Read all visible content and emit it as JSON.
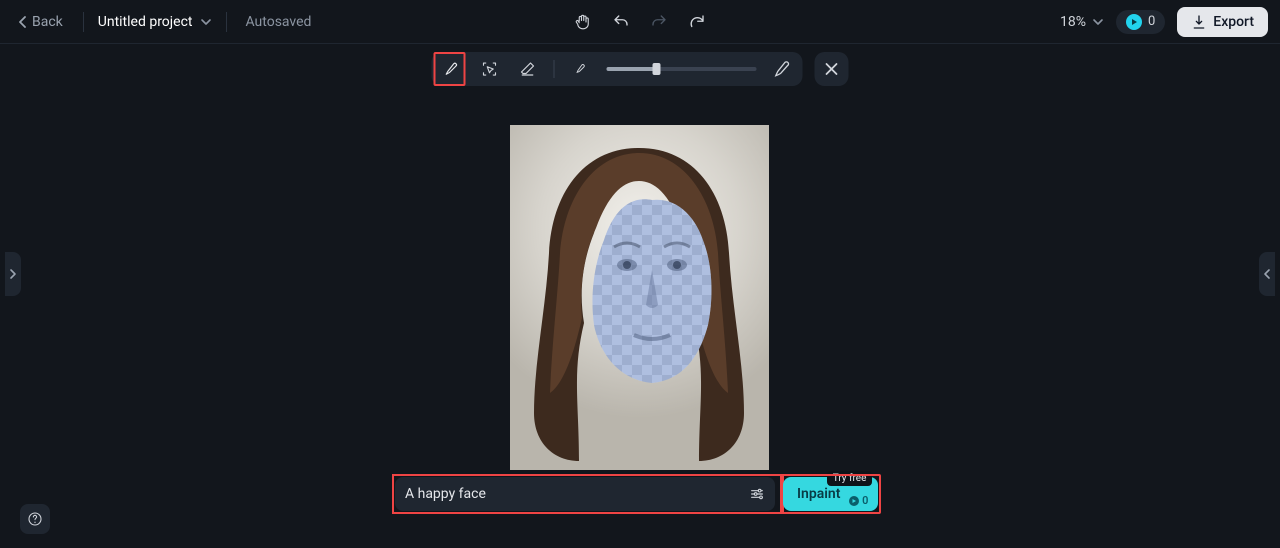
{
  "header": {
    "back_label": "Back",
    "project_name": "Untitled project",
    "autosave_label": "Autosaved",
    "zoom_label": "18%",
    "credits": "0",
    "export_label": "Export"
  },
  "toolbar": {
    "brush_selected": true,
    "brush_size_percent": 33
  },
  "prompt": {
    "text": "A happy face",
    "action_label": "Inpaint",
    "badge_label": "Try free",
    "cost_label": "0"
  }
}
